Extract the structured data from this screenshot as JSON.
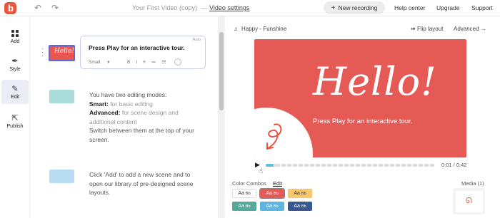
{
  "topbar": {
    "title": "Your First Video (copy)",
    "separator": "—",
    "video_settings": "Video settings",
    "new_recording": "New recording",
    "help_center": "Help center",
    "upgrade": "Upgrade",
    "support": "Support",
    "brand_color": "#e8553f"
  },
  "sidebar": {
    "items": [
      {
        "label": "Add",
        "icon": "grid-icon"
      },
      {
        "label": "Style",
        "icon": "brush-icon"
      },
      {
        "label": "Edit",
        "icon": "pencil-icon",
        "active": true
      },
      {
        "label": "Publish",
        "icon": "share-icon"
      }
    ]
  },
  "scenes": {
    "current_text": "Press Play for an interactive tour.",
    "auto_tag": "Auto",
    "text_size": "Small",
    "format_buttons": [
      "B",
      "I",
      "≡",
      "≔",
      "☷"
    ],
    "help1": {
      "intro": "You have two editing modes:",
      "smart_label": "Smart:",
      "smart_desc": "for basic editing",
      "advanced_label": "Advanced:",
      "advanced_desc": "for scene design and additional content",
      "outro": "Switch between them at the top of your screen."
    },
    "help2": "Click 'Add' to add a new scene and to open our library of pre-designed scene layouts."
  },
  "preview": {
    "music": "Happy - Funshine",
    "flip_layout": "Flip layout",
    "advanced": "Advanced",
    "hello": "Hello!",
    "subtitle": "Press Play for an interactive tour.",
    "time": "0:01 / 0:42",
    "progress": 0.02,
    "video_bg": "#e65a55"
  },
  "combos": {
    "label": "Color Combos",
    "edit": "Edit",
    "media": "Media (1)",
    "swatches": [
      {
        "text": "Aa",
        "sub": "Bb",
        "bg": "#ffffff",
        "fg": "#333333"
      },
      {
        "text": "Aa",
        "sub": "Bb",
        "bg": "#e65a55",
        "fg": "#ffffff"
      },
      {
        "text": "Aa",
        "sub": "Bb",
        "bg": "#f6c76b",
        "fg": "#333333"
      },
      {
        "text": "Aa",
        "sub": "Bb",
        "bg": "#55a99a",
        "fg": "#ffffff"
      },
      {
        "text": "Aa",
        "sub": "Bb",
        "bg": "#5fb5e0",
        "fg": "#ffffff"
      },
      {
        "text": "Aa",
        "sub": "Bb",
        "bg": "#37588f",
        "fg": "#ffffff"
      }
    ]
  }
}
